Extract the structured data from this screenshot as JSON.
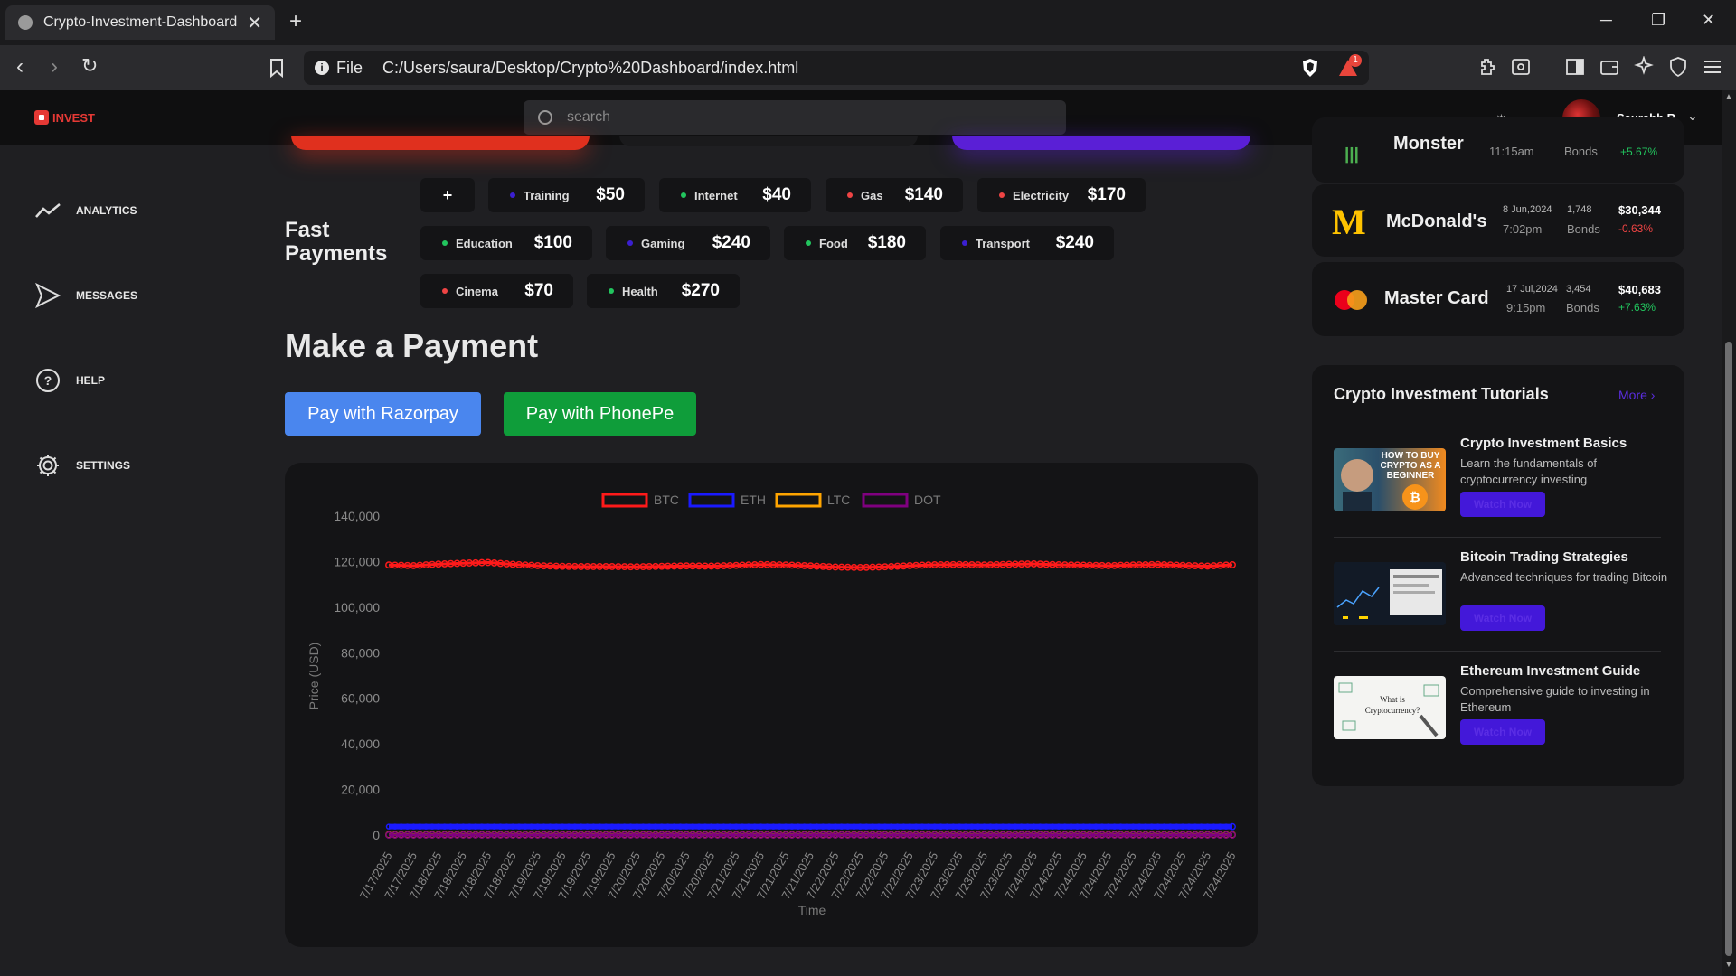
{
  "browser": {
    "tab_title": "Crypto-Investment-Dashboard",
    "new_tab": "+",
    "close": "✕",
    "file_label": "File",
    "url": "C:/Users/saura/Desktop/Crypto%20Dashboard/index.html",
    "badge": "1"
  },
  "header": {
    "logo_text": "INVEST",
    "search_placeholder": "search",
    "user_name": "Saurabh R"
  },
  "sidebar": {
    "items": [
      {
        "label": "ANALYTICS"
      },
      {
        "label": "MESSAGES"
      },
      {
        "label": "HELP"
      },
      {
        "label": "SETTINGS"
      }
    ]
  },
  "fast_payments": {
    "title_line1": "Fast",
    "title_line2": "Payments",
    "add": "+",
    "chips": [
      {
        "name": "Training",
        "amount": "$50",
        "color": "#3b1fd1"
      },
      {
        "name": "Internet",
        "amount": "$40",
        "color": "#22c55e"
      },
      {
        "name": "Gas",
        "amount": "$140",
        "color": "#ef4444"
      },
      {
        "name": "Electricity",
        "amount": "$170",
        "color": "#ef4444"
      },
      {
        "name": "Education",
        "amount": "$100",
        "color": "#22c55e"
      },
      {
        "name": "Gaming",
        "amount": "$240",
        "color": "#3b1fd1"
      },
      {
        "name": "Food",
        "amount": "$180",
        "color": "#22c55e"
      },
      {
        "name": "Transport",
        "amount": "$240",
        "color": "#3b1fd1"
      },
      {
        "name": "Cinema",
        "amount": "$70",
        "color": "#ef4444"
      },
      {
        "name": "Health",
        "amount": "$270",
        "color": "#22c55e"
      }
    ]
  },
  "payment": {
    "title": "Make a Payment",
    "razorpay": "Pay with Razorpay",
    "phonepe": "Pay with PhonePe"
  },
  "chart_data": {
    "type": "line",
    "xlabel": "Time",
    "ylabel": "Price (USD)",
    "ylim": [
      0,
      140000
    ],
    "yticks": [
      "140,000",
      "120,000",
      "100,000",
      "80,000",
      "60,000",
      "40,000",
      "20,000",
      "0"
    ],
    "legend_position": "top-center",
    "categories": [
      "7/17/2025",
      "7/17/2025",
      "7/18/2025",
      "7/18/2025",
      "7/18/2025",
      "7/18/2025",
      "7/19/2025",
      "7/19/2025",
      "7/19/2025",
      "7/19/2025",
      "7/20/2025",
      "7/20/2025",
      "7/20/2025",
      "7/20/2025",
      "7/21/2025",
      "7/21/2025",
      "7/21/2025",
      "7/21/2025",
      "7/22/2025",
      "7/22/2025",
      "7/22/2025",
      "7/22/2025",
      "7/23/2025",
      "7/23/2025",
      "7/23/2025",
      "7/23/2025",
      "7/24/2025",
      "7/24/2025",
      "7/24/2025",
      "7/24/2025",
      "7/24/2025",
      "7/24/2025",
      "7/24/2025",
      "7/24/2025",
      "7/24/2025"
    ],
    "series": [
      {
        "name": "BTC",
        "color": "#ff1a1a",
        "values": [
          118500,
          118200,
          118900,
          119300,
          119600,
          118800,
          118200,
          117900,
          117800,
          117800,
          117700,
          117900,
          118100,
          118000,
          118300,
          118700,
          118500,
          118100,
          117600,
          117400,
          117700,
          118200,
          118600,
          118700,
          118500,
          118800,
          119000,
          118600,
          118400,
          118200,
          118500,
          118700,
          118300,
          118000,
          118600
        ]
      },
      {
        "name": "ETH",
        "color": "#1a1aff",
        "values": [
          3700,
          3700,
          3700,
          3700,
          3700,
          3700,
          3700,
          3700,
          3700,
          3700,
          3700,
          3700,
          3700,
          3700,
          3700,
          3700,
          3700,
          3700,
          3700,
          3700,
          3700,
          3700,
          3700,
          3700,
          3700,
          3700,
          3700,
          3700,
          3700,
          3700,
          3700,
          3700,
          3700,
          3700,
          3700
        ]
      },
      {
        "name": "LTC",
        "color": "#ffa500",
        "values": [
          110,
          110,
          110,
          110,
          110,
          110,
          110,
          110,
          110,
          110,
          110,
          110,
          110,
          110,
          110,
          110,
          110,
          110,
          110,
          110,
          110,
          110,
          110,
          110,
          110,
          110,
          110,
          110,
          110,
          110,
          110,
          110,
          110,
          110,
          110
        ]
      },
      {
        "name": "DOT",
        "color": "#800080",
        "values": [
          4,
          4,
          4,
          4,
          4,
          4,
          4,
          4,
          4,
          4,
          4,
          4,
          4,
          4,
          4,
          4,
          4,
          4,
          4,
          4,
          4,
          4,
          4,
          4,
          4,
          4,
          4,
          4,
          4,
          4,
          4,
          4,
          4,
          4,
          4
        ]
      }
    ]
  },
  "stocks": [
    {
      "name": "Monster",
      "date": "",
      "time": "11:15am",
      "count": "",
      "type": "Bonds",
      "price": "",
      "change": "+5.67%",
      "change_color": "#22c55e"
    },
    {
      "name": "McDonald's",
      "date": "8 Jun,2024",
      "time": "7:02pm",
      "count": "1,748",
      "type": "Bonds",
      "price": "$30,344",
      "change": "-0.63%",
      "change_color": "#ef4444"
    },
    {
      "name": "Master Card",
      "date": "17 Jul,2024",
      "time": "9:15pm",
      "count": "3,454",
      "type": "Bonds",
      "price": "$40,683",
      "change": "+7.63%",
      "change_color": "#22c55e"
    }
  ],
  "tutorials": {
    "title": "Crypto Investment Tutorials",
    "more": "More ›",
    "items": [
      {
        "title": "Crypto Investment Basics",
        "desc": "Learn the fundamentals of cryptocurrency investing",
        "button": "Watch Now",
        "thumb_text": "HOW TO BUY CRYPTO AS A BEGINNER"
      },
      {
        "title": "Bitcoin Trading Strategies",
        "desc": "Advanced techniques for trading Bitcoin",
        "button": "Watch Now",
        "thumb_text": ""
      },
      {
        "title": "Ethereum Investment Guide",
        "desc": "Comprehensive guide to investing in Ethereum",
        "button": "Watch Now",
        "thumb_text": "What is Cryptocurrency?"
      }
    ]
  }
}
